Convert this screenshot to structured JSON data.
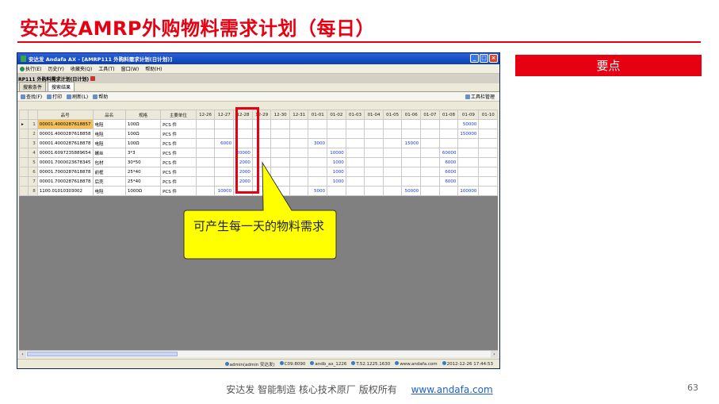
{
  "slide": {
    "title": "安达发AMRP外购物料需求计划（每日）",
    "keypoint_label": "要点",
    "callout": "可产生每一天的物料需求",
    "footer_text": "安达发   智能制造 核心技术原厂   版权所有",
    "footer_link": "www.andafa.com",
    "page_number": "63",
    "accent_color": "#e60012"
  },
  "window": {
    "title": "安达发 Andafa AX - [AMRP111 外购料需求计划(日计划)]",
    "menu": [
      {
        "label": "执行(E)",
        "icon": "run-icon"
      },
      {
        "label": "历史(Y)",
        "icon": ""
      },
      {
        "label": "收藏夹(Q)",
        "icon": ""
      },
      {
        "label": "工具(T)",
        "icon": ""
      },
      {
        "label": "窗口(W)",
        "icon": ""
      },
      {
        "label": "帮助(H)",
        "icon": ""
      }
    ],
    "doc_tab": "RP111 外购料需求计划(日计划)",
    "subtabs": [
      "搜索条件",
      "搜索结果"
    ],
    "toolbar": {
      "query": "查找(F)",
      "print": "打印",
      "refresh": "刷新(L)",
      "help": "帮助",
      "toolbar_mgmt": "工具栏管理"
    },
    "grid": {
      "headers": [
        "品号",
        "品名",
        "规格",
        "主要单位",
        "12-26",
        "12-27",
        "12-28",
        "12-29",
        "12-30",
        "12-31",
        "01-01",
        "01-02",
        "01-03",
        "01-04",
        "01-05",
        "01-06",
        "01-07",
        "01-08",
        "01-09",
        "01-10"
      ],
      "rows": [
        {
          "idx": "1",
          "code": "00001.4000287618857",
          "name": "电阻",
          "spec": "100Ω",
          "unit": "PCS 件",
          "qty": [
            "",
            "",
            "",
            "",
            "",
            "",
            "",
            "",
            "",
            "",
            "",
            "",
            "",
            "",
            "50000",
            ""
          ]
        },
        {
          "idx": "2",
          "code": "00001.4000287618858",
          "name": "电阻",
          "spec": "100Ω",
          "unit": "PCS 件",
          "qty": [
            "",
            "",
            "",
            "",
            "",
            "",
            "",
            "",
            "",
            "",
            "",
            "",
            "",
            "",
            "150000",
            ""
          ]
        },
        {
          "idx": "3",
          "code": "00001.4000287618878",
          "name": "电阻",
          "spec": "100Ω",
          "unit": "PCS 件",
          "qty": [
            "",
            "6000",
            "",
            "",
            "",
            "",
            "3000",
            "",
            "",
            "",
            "",
            "15000",
            "",
            "",
            "",
            ""
          ]
        },
        {
          "idx": "4",
          "code": "00001.6097235889654",
          "name": "螺丝",
          "spec": "3*3",
          "unit": "PCS 件",
          "qty": [
            "",
            "",
            "20000",
            "",
            "",
            "",
            "",
            "10000",
            "",
            "",
            "",
            "",
            "",
            "60000",
            "",
            ""
          ]
        },
        {
          "idx": "5",
          "code": "00001.7000023678345",
          "name": "包材",
          "spec": "30*50",
          "unit": "PCS 件",
          "qty": [
            "",
            "",
            "2000",
            "",
            "",
            "",
            "",
            "1000",
            "",
            "",
            "",
            "",
            "",
            "6000",
            "",
            ""
          ]
        },
        {
          "idx": "6",
          "code": "00001.7000287618878",
          "name": "前框",
          "spec": "25*40",
          "unit": "PCS 件",
          "qty": [
            "",
            "",
            "2000",
            "",
            "",
            "",
            "",
            "1000",
            "",
            "",
            "",
            "",
            "",
            "6000",
            "",
            ""
          ]
        },
        {
          "idx": "7",
          "code": "00001.7000287618878",
          "name": "后壳",
          "spec": "25*40",
          "unit": "PCS 件",
          "qty": [
            "",
            "",
            "2000",
            "",
            "",
            "",
            "",
            "1000",
            "",
            "",
            "",
            "",
            "",
            "6000",
            "",
            ""
          ]
        },
        {
          "idx": "8",
          "code": "1100.01010303002",
          "name": "电阻",
          "spec": "1000Ω",
          "unit": "PCS 件",
          "qty": [
            "",
            "10000",
            "",
            "",
            "",
            "",
            "5000",
            "",
            "",
            "",
            "",
            "50000",
            "",
            "",
            "100000",
            ""
          ]
        }
      ]
    },
    "status": {
      "user": "admin(admin 安达发)",
      "db": "C09:8090",
      "server": "andb_ax_1226",
      "version": "T.52.1225.1630",
      "site": "www.andafa.com",
      "datetime": "2012-12-26 17:44:53"
    }
  }
}
